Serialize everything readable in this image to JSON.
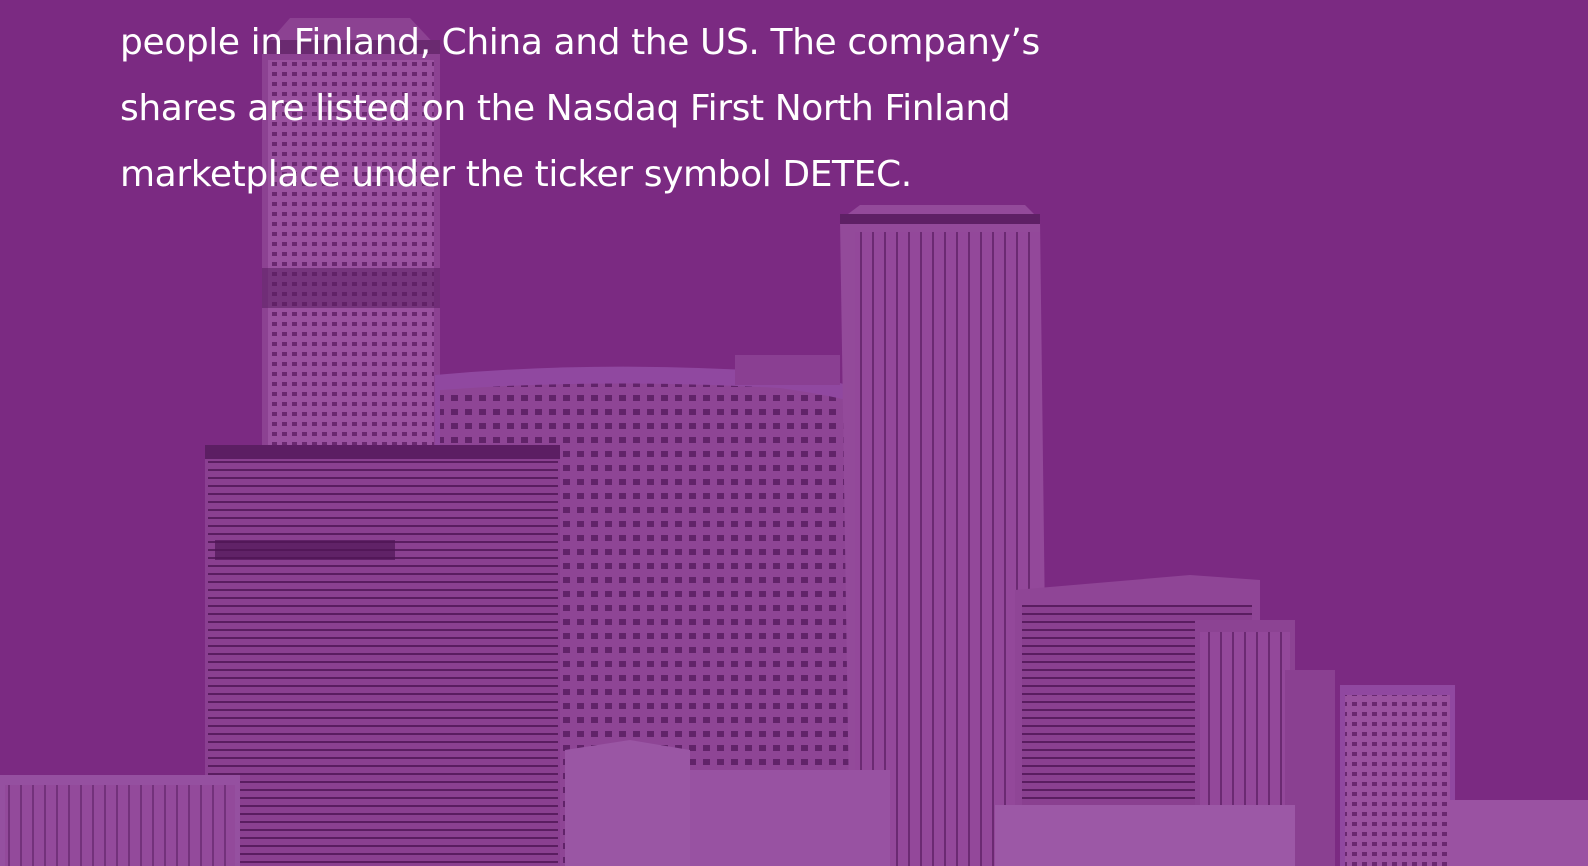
{
  "hero": {
    "background_color": "#7b2a82",
    "image_icon": "city-skyline-photo",
    "text_lines": [
      "people in Finland, China and the US. The company’s",
      "shares are listed on the Nasdaq First North Finland",
      "marketplace under the ticker symbol DETEC."
    ]
  }
}
